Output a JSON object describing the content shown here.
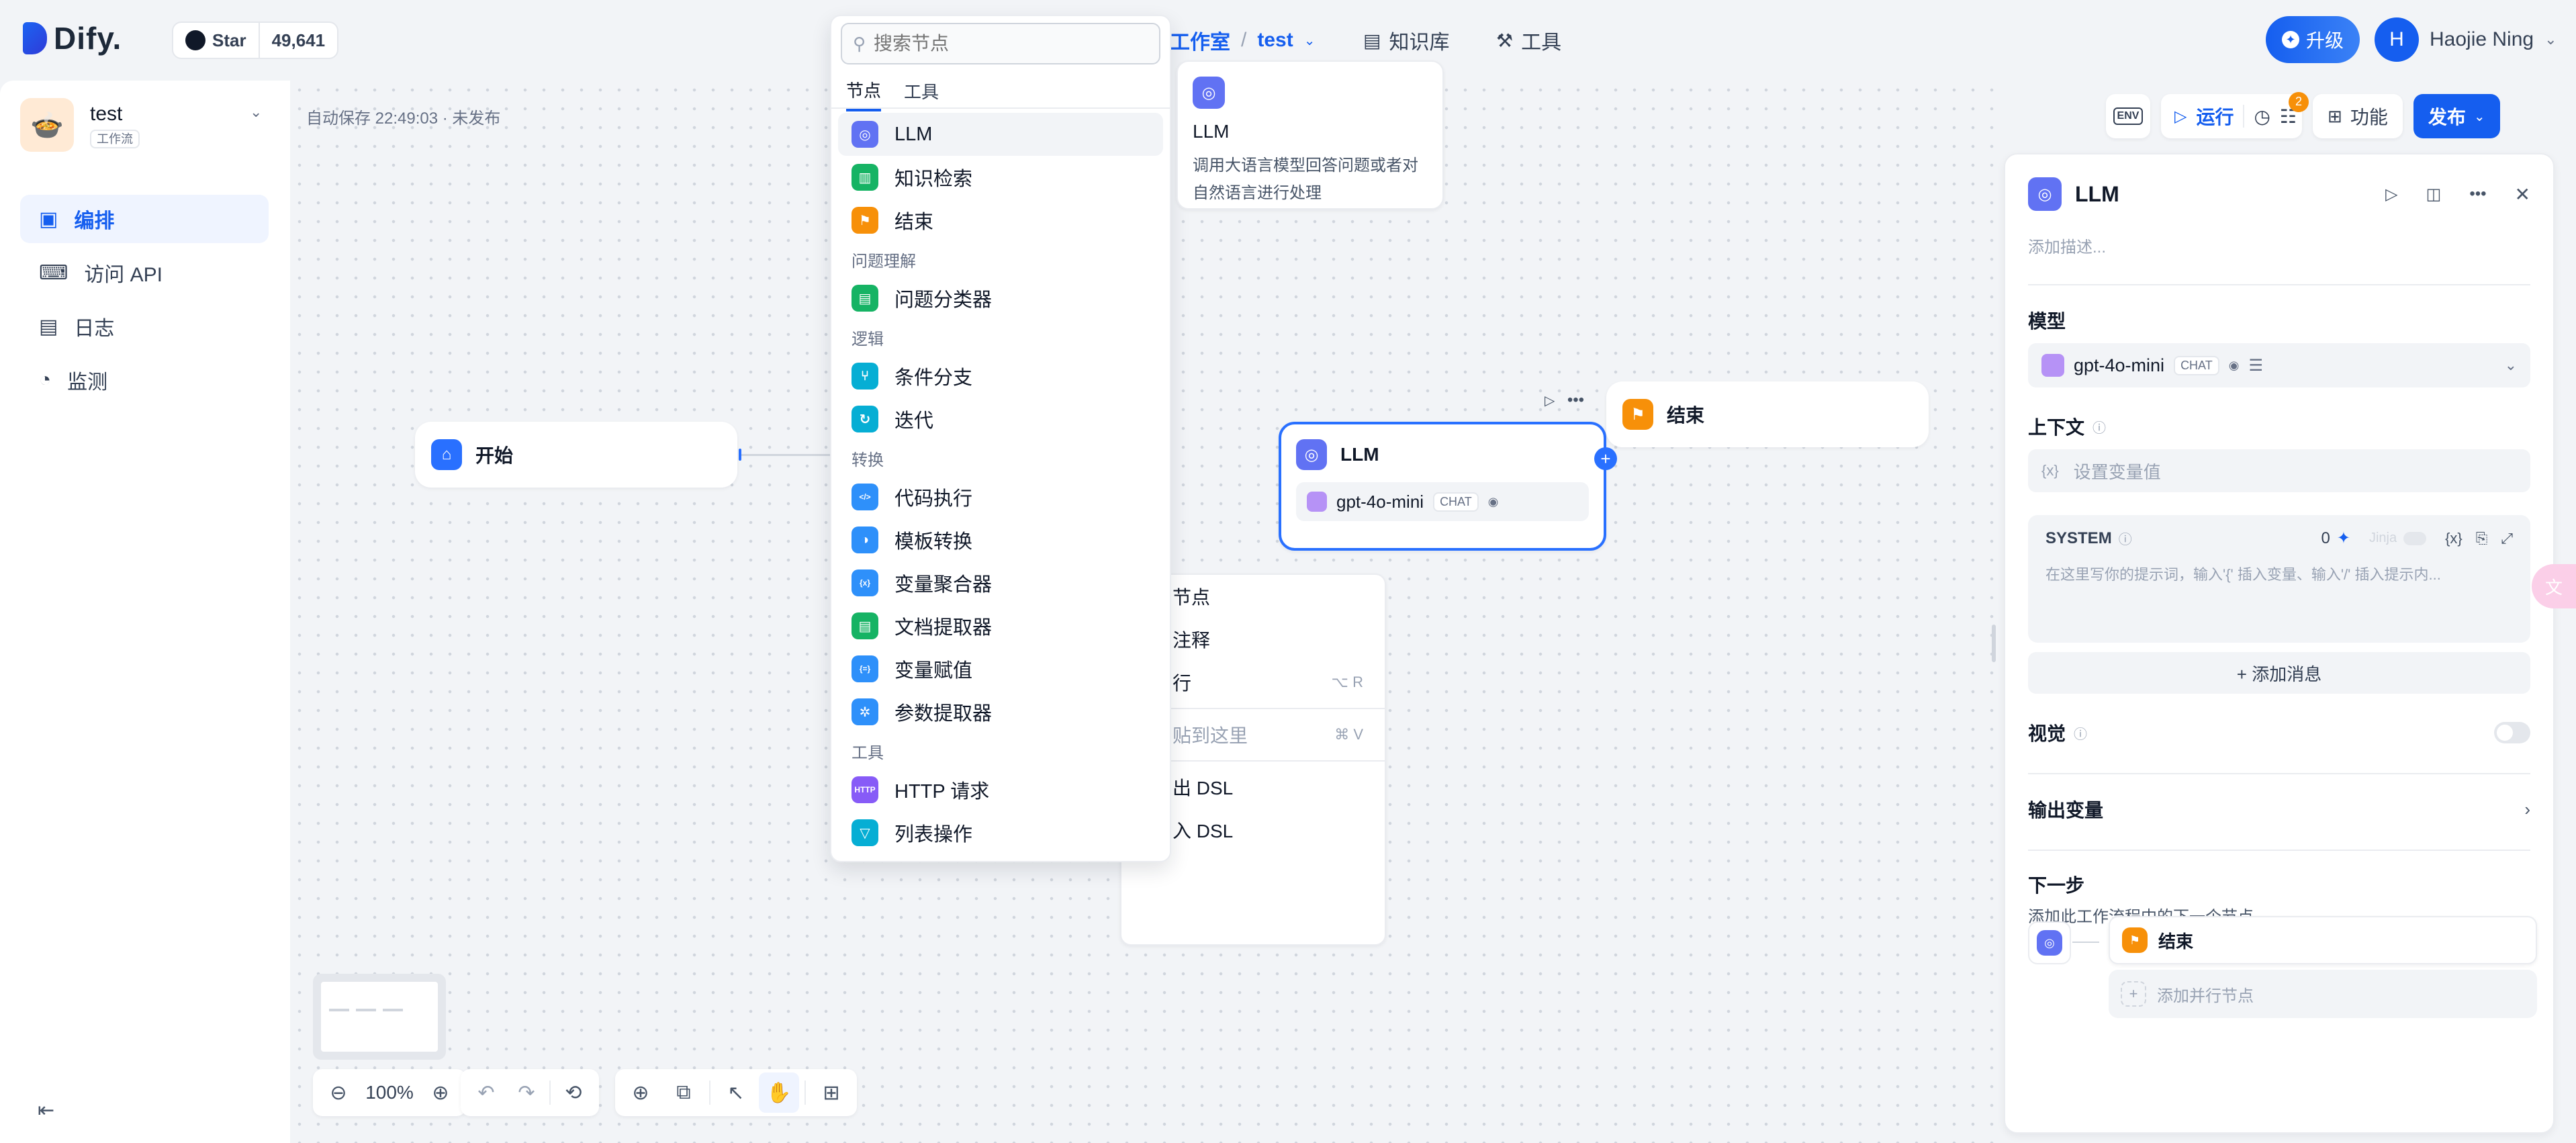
{
  "header": {
    "brand": "Dify.",
    "github_star_label": "Star",
    "github_star_count": "49,641",
    "breadcrumb_studio": "工作室",
    "breadcrumb_sep": "/",
    "breadcrumb_app": "test",
    "nav_knowledge": "知识库",
    "nav_tools": "工具",
    "upgrade_label": "升级",
    "avatar_initial": "H",
    "user_name": "Haojie Ning"
  },
  "sidebar": {
    "app_name": "test",
    "app_type": "工作流",
    "items": [
      {
        "label": "编排",
        "icon": "layout-icon",
        "active": true
      },
      {
        "label": "访问 API",
        "icon": "terminal-icon",
        "active": false
      },
      {
        "label": "日志",
        "icon": "log-icon",
        "active": false
      },
      {
        "label": "监测",
        "icon": "monitor-icon",
        "active": false
      }
    ]
  },
  "canvas": {
    "autosave_status": "自动保存 22:49:03 · 未发布",
    "start_node_label": "开始",
    "llm_node_label": "LLM",
    "llm_node_model": "gpt-4o-mini",
    "llm_node_model_tag": "CHAT",
    "end_node_label": "结束",
    "zoom_level": "100%"
  },
  "toolbar": {
    "env_label": "ENV",
    "run_label": "运行",
    "checklist_badge": "2",
    "features_label": "功能",
    "publish_label": "发布"
  },
  "node_picker": {
    "search_placeholder": "搜索节点",
    "tab_nodes": "节点",
    "tab_tools": "工具",
    "groups": [
      {
        "title": "",
        "items": [
          {
            "label": "LLM",
            "color": "#6172f3",
            "glyph": "◎"
          },
          {
            "label": "知识检索",
            "color": "#16b364",
            "glyph": "▥"
          },
          {
            "label": "结束",
            "color": "#f79009",
            "glyph": "⚑"
          }
        ]
      },
      {
        "title": "问题理解",
        "items": [
          {
            "label": "问题分类器",
            "color": "#16b364",
            "glyph": "▤"
          }
        ]
      },
      {
        "title": "逻辑",
        "items": [
          {
            "label": "条件分支",
            "color": "#06aed4",
            "glyph": "⑂"
          },
          {
            "label": "迭代",
            "color": "#06aed4",
            "glyph": "↻"
          }
        ]
      },
      {
        "title": "转换",
        "items": [
          {
            "label": "代码执行",
            "color": "#2e90fa",
            "glyph": "</>"
          },
          {
            "label": "模板转换",
            "color": "#2e90fa",
            "glyph": "◑"
          },
          {
            "label": "变量聚合器",
            "color": "#2e90fa",
            "glyph": "{x}"
          },
          {
            "label": "文档提取器",
            "color": "#16b364",
            "glyph": "▤"
          },
          {
            "label": "变量赋值",
            "color": "#2e90fa",
            "glyph": "{=}"
          },
          {
            "label": "参数提取器",
            "color": "#2e90fa",
            "glyph": "✲"
          }
        ]
      },
      {
        "title": "工具",
        "items": [
          {
            "label": "HTTP 请求",
            "color": "#875bf7",
            "glyph": "HTTP"
          },
          {
            "label": "列表操作",
            "color": "#06aed4",
            "glyph": "▽"
          }
        ]
      }
    ]
  },
  "node_tooltip": {
    "title": "LLM",
    "description_line1": "调用大语言模型回答问题或者对",
    "description_line2": "自然语言进行处理"
  },
  "context_menu": {
    "items": [
      "节点",
      "注释",
      "行",
      "贴到这里",
      "出 DSL",
      "入 DSL"
    ],
    "shortcut_run": "⌥ R",
    "shortcut_paste": "⌘ V"
  },
  "panel": {
    "title": "LLM",
    "description_placeholder": "添加描述...",
    "model_label": "模型",
    "model_name": "gpt-4o-mini",
    "model_tag": "CHAT",
    "context_label": "上下文",
    "context_placeholder": "设置变量值",
    "system_label": "SYSTEM",
    "system_count": "0",
    "jinja_label": "Jinja",
    "system_placeholder": "在这里写你的提示词，输入'{' 插入变量、输入'/' 插入提示内...",
    "add_message_label": "+ 添加消息",
    "vision_label": "视觉",
    "output_vars_label": "输出变量",
    "next_step_label": "下一步",
    "next_step_desc": "添加此工作流程中的下一个节点",
    "next_node_label": "结束",
    "add_parallel_label": "添加并行节点"
  },
  "colors": {
    "accent": "#155eef",
    "llm": "#6172f3",
    "end": "#f79009",
    "start": "#2970ff"
  }
}
